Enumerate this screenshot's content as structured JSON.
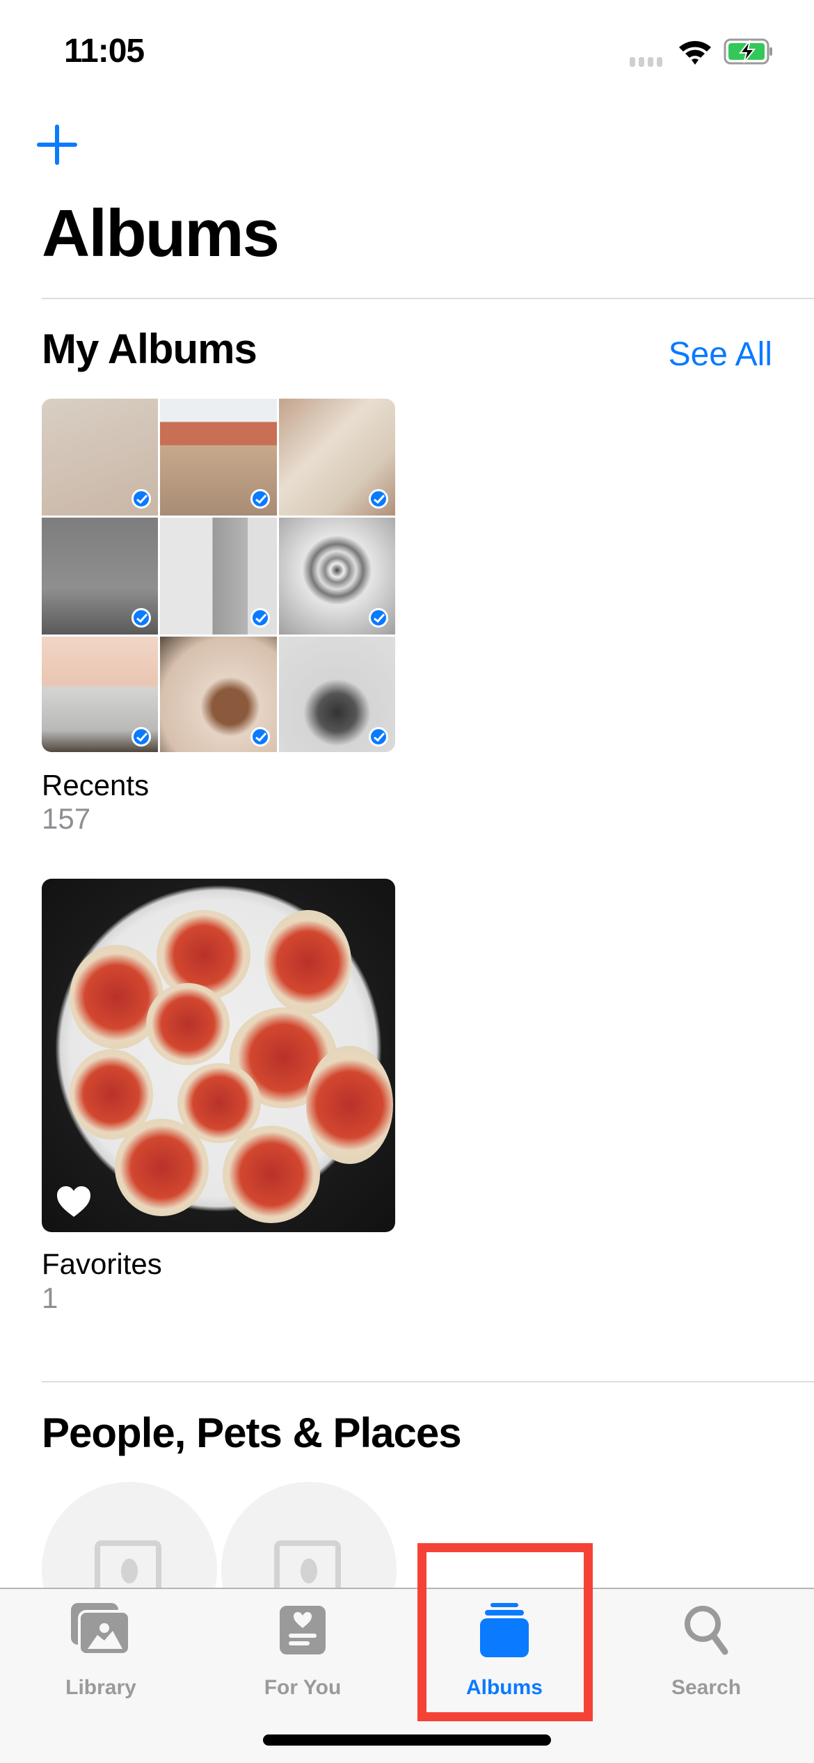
{
  "status_bar": {
    "time": "11:05"
  },
  "header": {
    "add_label": "+",
    "title": "Albums"
  },
  "my_albums": {
    "title": "My Albums",
    "see_all": "See All",
    "albums": [
      {
        "name": "Recents",
        "count": "157",
        "selected_thumbnails": 9
      },
      {
        "name": "Favorites",
        "count": "1"
      }
    ]
  },
  "people_section": {
    "title": "People, Pets & Places"
  },
  "tabs": [
    {
      "label": "Library",
      "icon": "photo-library-icon",
      "active": false
    },
    {
      "label": "For You",
      "icon": "for-you-icon",
      "active": false
    },
    {
      "label": "Albums",
      "icon": "albums-icon",
      "active": true
    },
    {
      "label": "Search",
      "icon": "search-icon",
      "active": false
    }
  ],
  "colors": {
    "accent": "#0a7aff",
    "highlight": "#f44336",
    "battery": "#34c759"
  }
}
